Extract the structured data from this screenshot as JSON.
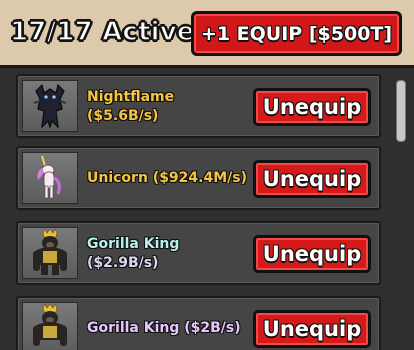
{
  "header": {
    "active_count": "17/17 Active",
    "equip_button_label": "+1 EQUIP [$500T]"
  },
  "pets": [
    {
      "name": "Nightflame",
      "rate": "($5.6B/s)",
      "name_color": "#f5c542",
      "rate_color": "#f5c542",
      "icon": "nightflame-pet-icon",
      "button": "Unequip"
    },
    {
      "name": "Unicorn ($924.4M/s)",
      "rate": "",
      "name_color": "#f5c542",
      "rate_color": "#f5c542",
      "icon": "unicorn-pet-icon",
      "button": "Unequip"
    },
    {
      "name": "Gorilla King",
      "rate": "($2.9B/s)",
      "name_color": "#b8f0ea",
      "rate_color": "#d8d8f0",
      "icon": "gorilla-king-pet-icon",
      "button": "Unequip"
    },
    {
      "name": "Gorilla King ($2B/s)",
      "rate": "",
      "name_color": "#e6c6ff",
      "rate_color": "#e6c6ff",
      "icon": "gorilla-king-pet-icon",
      "button": "Unequip"
    }
  ]
}
